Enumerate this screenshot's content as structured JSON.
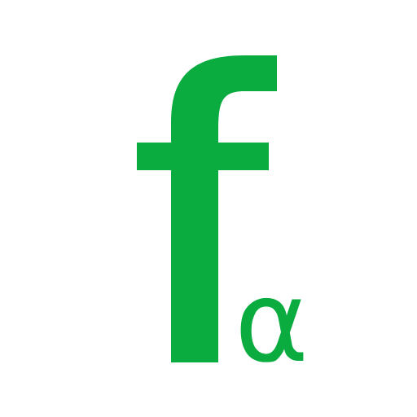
{
  "logo": {
    "letter": "f",
    "subscript": "α",
    "color": "#0aab3f",
    "background": "#ffffff"
  }
}
